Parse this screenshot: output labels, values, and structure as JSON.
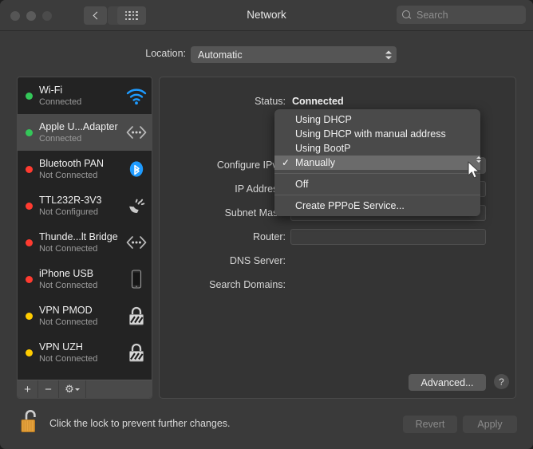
{
  "window": {
    "title": "Network",
    "traffic_lights": [
      "close",
      "minimize",
      "maximize"
    ]
  },
  "toolbar": {
    "back_icon": "chevron-left-icon",
    "forward_icon": "chevron-right-icon",
    "grid_icon": "show-all-grid-icon",
    "search": {
      "icon": "search-icon",
      "placeholder": "Search",
      "value": ""
    }
  },
  "location": {
    "label": "Location:",
    "selected": "Automatic"
  },
  "sidebar": {
    "services": [
      {
        "name": "Wi-Fi",
        "status": "Connected",
        "dot": "#34c759",
        "icon": "wifi-icon",
        "selected": false
      },
      {
        "name": "Apple U...Adapter",
        "status": "Connected",
        "dot": "#34c759",
        "icon": "ethernet-icon",
        "selected": true
      },
      {
        "name": "Bluetooth PAN",
        "status": "Not Connected",
        "dot": "#ff3b30",
        "icon": "bluetooth-icon",
        "selected": false
      },
      {
        "name": "TTL232R-3V3",
        "status": "Not Configured",
        "dot": "#ff3b30",
        "icon": "modem-icon",
        "selected": false
      },
      {
        "name": "Thunde...lt Bridge",
        "status": "Not Connected",
        "dot": "#ff3b30",
        "icon": "ethernet-icon",
        "selected": false
      },
      {
        "name": "iPhone USB",
        "status": "Not Connected",
        "dot": "#ff3b30",
        "icon": "iphone-icon",
        "selected": false
      },
      {
        "name": "VPN PMOD",
        "status": "Not Connected",
        "dot": "#ffcc00",
        "icon": "vpn-lock-icon",
        "selected": false
      },
      {
        "name": "VPN UZH",
        "status": "Not Connected",
        "dot": "#ffcc00",
        "icon": "vpn-lock-icon",
        "selected": false
      }
    ],
    "toolbar": {
      "add_label": "+",
      "remove_label": "−",
      "gear_icon": "gear-icon"
    }
  },
  "main": {
    "status_label": "Status:",
    "status_value": "Connected",
    "fields": [
      {
        "label": "Configure IPv4:",
        "value": "",
        "type": "popup"
      },
      {
        "label": "IP Address:",
        "value": "",
        "type": "input"
      },
      {
        "label": "Subnet Mask:",
        "value": "",
        "type": "input"
      },
      {
        "label": "Router:",
        "value": "",
        "type": "input"
      },
      {
        "label": "DNS Server:",
        "value": "",
        "type": "none"
      },
      {
        "label": "Search Domains:",
        "value": "",
        "type": "none"
      }
    ],
    "advanced_label": "Advanced...",
    "help_label": "?"
  },
  "dropdown": {
    "items": [
      {
        "label": "Using DHCP",
        "checked": false,
        "highlighted": false,
        "separator_after": false
      },
      {
        "label": "Using DHCP with manual address",
        "checked": false,
        "highlighted": false,
        "separator_after": false
      },
      {
        "label": "Using BootP",
        "checked": false,
        "highlighted": false,
        "separator_after": false
      },
      {
        "label": "Manually",
        "checked": true,
        "highlighted": true,
        "separator_after": true
      },
      {
        "label": "Off",
        "checked": false,
        "highlighted": false,
        "separator_after": true
      },
      {
        "label": "Create PPPoE Service...",
        "checked": false,
        "highlighted": false,
        "separator_after": false
      }
    ],
    "check_glyph": "✓"
  },
  "bottom": {
    "lock_icon": "unlocked-padlock-icon",
    "lock_text": "Click the lock to prevent further changes.",
    "revert_label": "Revert",
    "apply_label": "Apply"
  },
  "colors": {
    "accent_blue": "#1e9bff",
    "green_dot": "#34c759",
    "red_dot": "#ff3b30",
    "yellow_dot": "#ffcc00",
    "lock_gold": "#e8a33d"
  }
}
